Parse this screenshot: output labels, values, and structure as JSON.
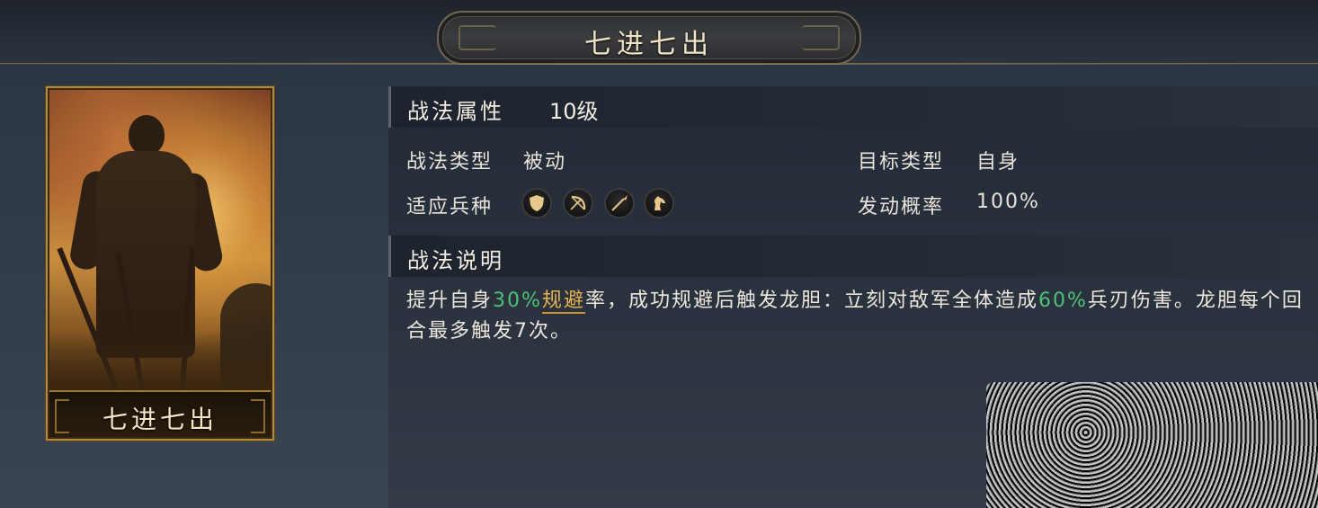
{
  "header": {
    "title": "七进七出"
  },
  "card": {
    "name": "七进七出"
  },
  "attributes": {
    "title": "战法属性",
    "level": "10级",
    "type_label": "战法类型",
    "type_value": "被动",
    "target_label": "目标类型",
    "target_value": "自身",
    "troop_label": "适应兵种",
    "troop_icons": [
      "shield-icon",
      "bow-icon",
      "spear-icon",
      "horse-icon"
    ],
    "chance_label": "发动概率",
    "chance_value": "100%"
  },
  "description": {
    "title": "战法说明",
    "p1": "提升自身",
    "v1": "30%",
    "k1": "规避",
    "p2": "率，成功规避后触发龙胆：立刻对敌军全体造成",
    "v2": "60%",
    "p3": "兵刃伤害。龙胆每个回合最多触发7次。"
  },
  "colors": {
    "green": "#4ec07a",
    "gold": "#e5b350",
    "card_border": "#b48a3e"
  }
}
